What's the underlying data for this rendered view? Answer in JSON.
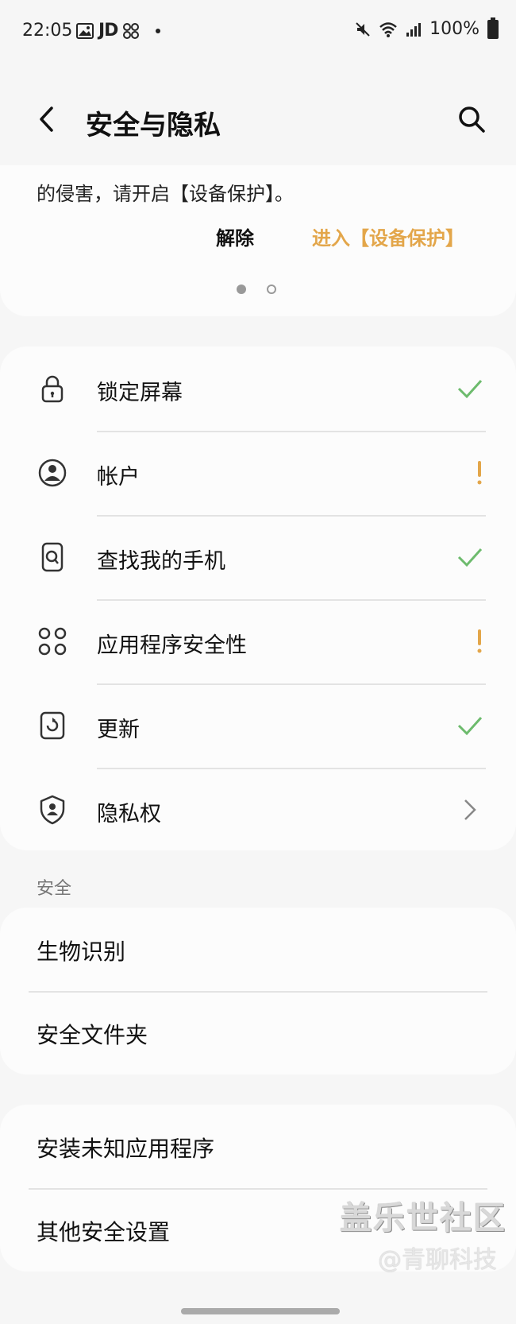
{
  "status_bar": {
    "time": "22:05",
    "jd": "JD",
    "battery": "100%"
  },
  "header": {
    "title": "安全与隐私"
  },
  "banner": {
    "text": "的侵害，请开启【设备保护】。",
    "dismiss": "解除",
    "enter": "进入【设备保护】"
  },
  "security_items": [
    {
      "label": "锁定屏幕",
      "icon": "lock-icon",
      "status": "ok"
    },
    {
      "label": "帐户",
      "icon": "account-icon",
      "status": "warning"
    },
    {
      "label": "查找我的手机",
      "icon": "find-phone-icon",
      "status": "ok"
    },
    {
      "label": "应用程序安全性",
      "icon": "apps-icon",
      "status": "warning"
    },
    {
      "label": "更新",
      "icon": "update-icon",
      "status": "ok"
    },
    {
      "label": "隐私权",
      "icon": "privacy-shield-icon",
      "status": "chevron"
    }
  ],
  "security_section": {
    "header": "安全",
    "items": [
      "生物识别",
      "安全文件夹"
    ]
  },
  "other_section": {
    "items": [
      "安装未知应用程序",
      "其他安全设置"
    ]
  },
  "watermark": {
    "line1": "盖乐世社区",
    "line2": "@青聊科技"
  },
  "colors": {
    "ok": "#6dbb6d",
    "warning": "#e3a64a",
    "accent": "#e3a64a"
  }
}
